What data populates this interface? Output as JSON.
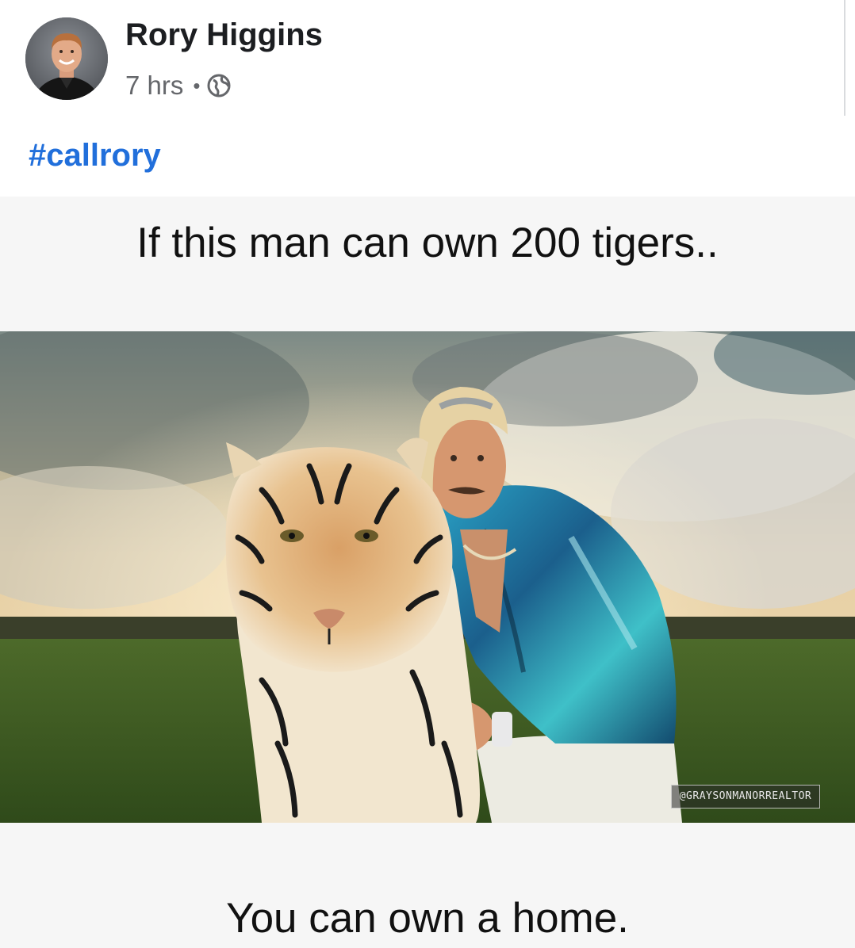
{
  "post": {
    "author": "Rory Higgins",
    "timestamp": "7 hrs",
    "separator": "•",
    "audience_icon": "globe-icon",
    "text": "#callrory"
  },
  "meme": {
    "top_caption": "If this man can own 200 tigers..",
    "bottom_caption": "You can own a home.",
    "watermark": "@GRAYSONMANORREALTOR"
  },
  "colors": {
    "hashtag": "#216fdb",
    "meta": "#65676b",
    "name": "#1c1e21"
  }
}
